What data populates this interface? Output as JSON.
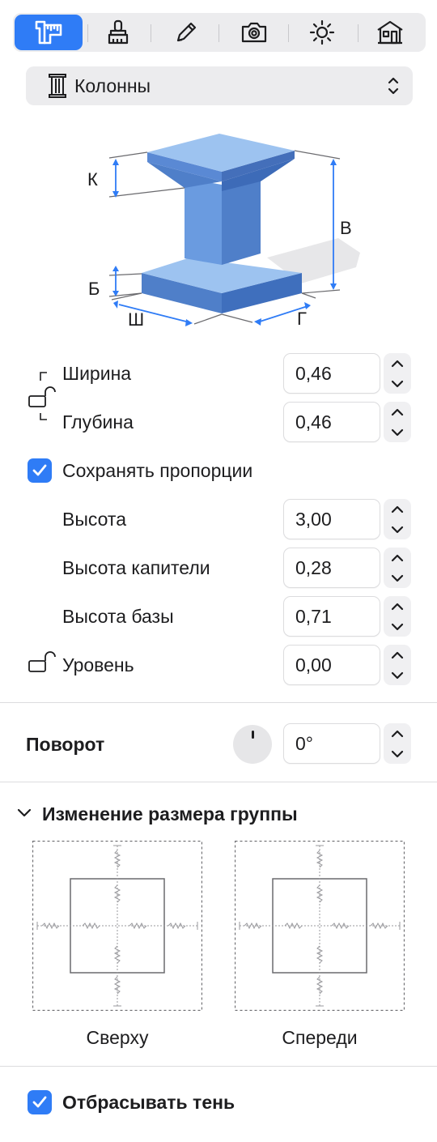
{
  "toolbar": {
    "tabs": [
      {
        "icon": "ruler-caliper-icon",
        "active": true
      },
      {
        "icon": "brush-icon",
        "active": false
      },
      {
        "icon": "pencil-icon",
        "active": false
      },
      {
        "icon": "camera-icon",
        "active": false
      },
      {
        "icon": "sun-icon",
        "active": false
      },
      {
        "icon": "house-icon",
        "active": false
      }
    ]
  },
  "type_select": {
    "label": "Колонны",
    "icon": "column-icon"
  },
  "diagram": {
    "labels": {
      "capital": "К",
      "height": "В",
      "base": "Б",
      "width": "Ш",
      "depth": "Г"
    }
  },
  "params": {
    "width": {
      "label": "Ширина",
      "value": "0,46"
    },
    "depth": {
      "label": "Глубина",
      "value": "0,46"
    },
    "keep_proportions": {
      "label": "Сохранять пропорции",
      "checked": true
    },
    "height": {
      "label": "Высота",
      "value": "3,00"
    },
    "capital_height": {
      "label": "Высота капители",
      "value": "0,28"
    },
    "base_height": {
      "label": "Высота базы",
      "value": "0,71"
    },
    "level": {
      "label": "Уровень",
      "value": "0,00"
    }
  },
  "rotation": {
    "label": "Поворот",
    "value": "0°"
  },
  "group_resize": {
    "title": "Изменение размера группы",
    "top_caption": "Сверху",
    "front_caption": "Спереди"
  },
  "shadow": {
    "label": "Отбрасывать тень",
    "checked": true
  },
  "colors": {
    "accent": "#2f7cf6",
    "column_face": "#6a9be0",
    "column_light": "#9dc3f0",
    "column_dark": "#4f7fc9"
  }
}
